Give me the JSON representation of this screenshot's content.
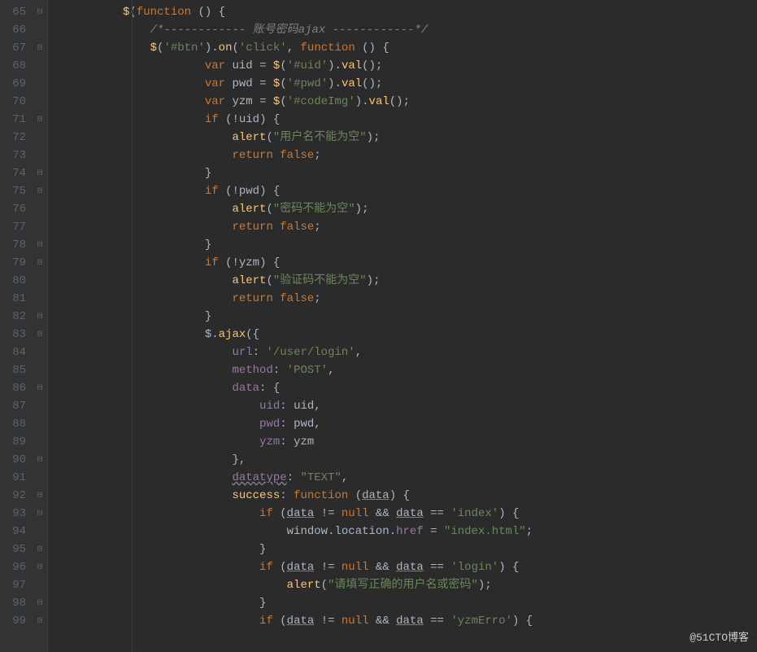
{
  "watermark": "@51CTO博客",
  "lines": [
    {
      "n": 65,
      "fold": "⊟",
      "html": "          <span class='fn'>$</span><span class='pun'>(</span><span class='kw'>function</span> <span class='pun'>() {</span>"
    },
    {
      "n": 66,
      "fold": "",
      "html": "              <span class='com'>/*------------ 账号密码ajax ------------*/</span>"
    },
    {
      "n": 67,
      "fold": "⊟",
      "html": "              <span class='fn'>$</span><span class='pun'>(</span><span class='str'>'#btn'</span><span class='pun'>).</span><span class='fn'>on</span><span class='pun'>(</span><span class='str'>'click'</span><span class='pun'>, </span><span class='kw'>function</span> <span class='pun'>() {</span>"
    },
    {
      "n": 68,
      "fold": "",
      "html": "                      <span class='kw'>var</span> <span class='pl'>uid</span> <span class='pun'>=</span> <span class='fn'>$</span><span class='pun'>(</span><span class='str'>'#uid'</span><span class='pun'>).</span><span class='fn'>val</span><span class='pun'>();</span>"
    },
    {
      "n": 69,
      "fold": "",
      "html": "                      <span class='kw'>var</span> <span class='pl'>pwd</span> <span class='pun'>=</span> <span class='fn'>$</span><span class='pun'>(</span><span class='str'>'#pwd'</span><span class='pun'>).</span><span class='fn'>val</span><span class='pun'>();</span>"
    },
    {
      "n": 70,
      "fold": "",
      "html": "                      <span class='kw'>var</span> <span class='pl'>yzm</span> <span class='pun'>=</span> <span class='fn'>$</span><span class='pun'>(</span><span class='str'>'#codeImg'</span><span class='pun'>).</span><span class='fn'>val</span><span class='pun'>();</span>"
    },
    {
      "n": 71,
      "fold": "⊟",
      "html": "                      <span class='kw'>if</span> <span class='pun'>(!</span><span class='pl'>uid</span><span class='pun'>) {</span>"
    },
    {
      "n": 72,
      "fold": "",
      "html": "                          <span class='fn'>alert</span><span class='pun'>(</span><span class='str'>\"用户名不能为空\"</span><span class='pun'>);</span>"
    },
    {
      "n": 73,
      "fold": "",
      "html": "                          <span class='kw'>return false</span><span class='pun'>;</span>"
    },
    {
      "n": 74,
      "fold": "⊟",
      "html": "                      <span class='pun'>}</span>"
    },
    {
      "n": 75,
      "fold": "⊟",
      "html": "                      <span class='kw'>if</span> <span class='pun'>(!</span><span class='pl'>pwd</span><span class='pun'>) {</span>"
    },
    {
      "n": 76,
      "fold": "",
      "html": "                          <span class='fn'>alert</span><span class='pun'>(</span><span class='str'>\"密码不能为空\"</span><span class='pun'>);</span>"
    },
    {
      "n": 77,
      "fold": "",
      "html": "                          <span class='kw'>return false</span><span class='pun'>;</span>"
    },
    {
      "n": 78,
      "fold": "⊟",
      "html": "                      <span class='pun'>}</span>"
    },
    {
      "n": 79,
      "fold": "⊟",
      "html": "                      <span class='kw'>if</span> <span class='pun'>(!</span><span class='pl'>yzm</span><span class='pun'>) {</span>"
    },
    {
      "n": 80,
      "fold": "",
      "html": "                          <span class='fn'>alert</span><span class='pun'>(</span><span class='str'>\"验证码不能为空\"</span><span class='pun'>);</span>"
    },
    {
      "n": 81,
      "fold": "",
      "html": "                          <span class='kw'>return false</span><span class='pun'>;</span>"
    },
    {
      "n": 82,
      "fold": "⊟",
      "html": "                      <span class='pun'>}</span>"
    },
    {
      "n": 83,
      "fold": "⊟",
      "html": "                      <span class='pl'>$</span><span class='pun'>.</span><span class='fn'>ajax</span><span class='pun'>({</span>"
    },
    {
      "n": 84,
      "fold": "",
      "html": "                          <span class='prop'>url</span><span class='pun'>: </span><span class='str'>'/user/login'</span><span class='pun'>,</span>"
    },
    {
      "n": 85,
      "fold": "",
      "html": "                          <span class='prop'>method</span><span class='pun'>: </span><span class='str'>'POST'</span><span class='pun'>,</span>"
    },
    {
      "n": 86,
      "fold": "⊟",
      "html": "                          <span class='prop'>data</span><span class='pun'>: {</span>"
    },
    {
      "n": 87,
      "fold": "",
      "html": "                              <span class='prop'>uid</span><span class='pun'>: </span><span class='pl'>uid</span><span class='pun'>,</span>"
    },
    {
      "n": 88,
      "fold": "",
      "html": "                              <span class='prop'>pwd</span><span class='pun'>: </span><span class='pl'>pwd</span><span class='pun'>,</span>"
    },
    {
      "n": 89,
      "fold": "",
      "html": "                              <span class='prop'>yzm</span><span class='pun'>: </span><span class='pl'>yzm</span>"
    },
    {
      "n": 90,
      "fold": "⊟",
      "html": "                          <span class='pun'>},</span>"
    },
    {
      "n": 91,
      "fold": "",
      "html": "                          <span class='prop wave'>datatype</span><span class='pun'>: </span><span class='str'>\"TEXT\"</span><span class='pun'>,</span>"
    },
    {
      "n": 92,
      "fold": "⊟",
      "html": "                          <span class='fn'>success</span><span class='pun'>: </span><span class='kw'>function</span> <span class='pun'>(</span><span class='pl ul'>data</span><span class='pun'>) {</span>"
    },
    {
      "n": 93,
      "fold": "⊟",
      "html": "                              <span class='kw'>if</span> <span class='pun'>(</span><span class='pl ul'>data</span> <span class='pun'>!=</span> <span class='kw'>null</span> <span class='pun'>&amp;&amp;</span> <span class='pl ul'>data</span> <span class='pun'>==</span> <span class='str'>'index'</span><span class='pun'>) {</span>"
    },
    {
      "n": 94,
      "fold": "",
      "html": "                                  <span class='pl'>window</span><span class='pun'>.</span><span class='pl'>location</span><span class='pun'>.</span><span class='prop'>href</span> <span class='pun'>=</span> <span class='str'>\"index.html\"</span><span class='pun'>;</span>"
    },
    {
      "n": 95,
      "fold": "⊟",
      "html": "                              <span class='pun'>}</span>"
    },
    {
      "n": 96,
      "fold": "⊟",
      "html": "                              <span class='kw'>if</span> <span class='pun'>(</span><span class='pl ul'>data</span> <span class='pun'>!=</span> <span class='kw'>null</span> <span class='pun'>&amp;&amp;</span> <span class='pl ul'>data</span> <span class='pun'>==</span> <span class='str'>'login'</span><span class='pun'>) {</span>"
    },
    {
      "n": 97,
      "fold": "",
      "html": "                                  <span class='fn'>alert</span><span class='pun'>(</span><span class='str'>\"请填写正确的用户名或密码\"</span><span class='pun'>);</span>"
    },
    {
      "n": 98,
      "fold": "⊟",
      "html": "                              <span class='pun'>}</span>"
    },
    {
      "n": 99,
      "fold": "⊟",
      "html": "                              <span class='kw'>if</span> <span class='pun'>(</span><span class='pl ul'>data</span> <span class='pun'>!=</span> <span class='kw'>null</span> <span class='pun'>&amp;&amp;</span> <span class='pl ul'>data</span> <span class='pun'>==</span> <span class='str'>'yzmErro'</span><span class='pun'>) {</span>"
    }
  ]
}
